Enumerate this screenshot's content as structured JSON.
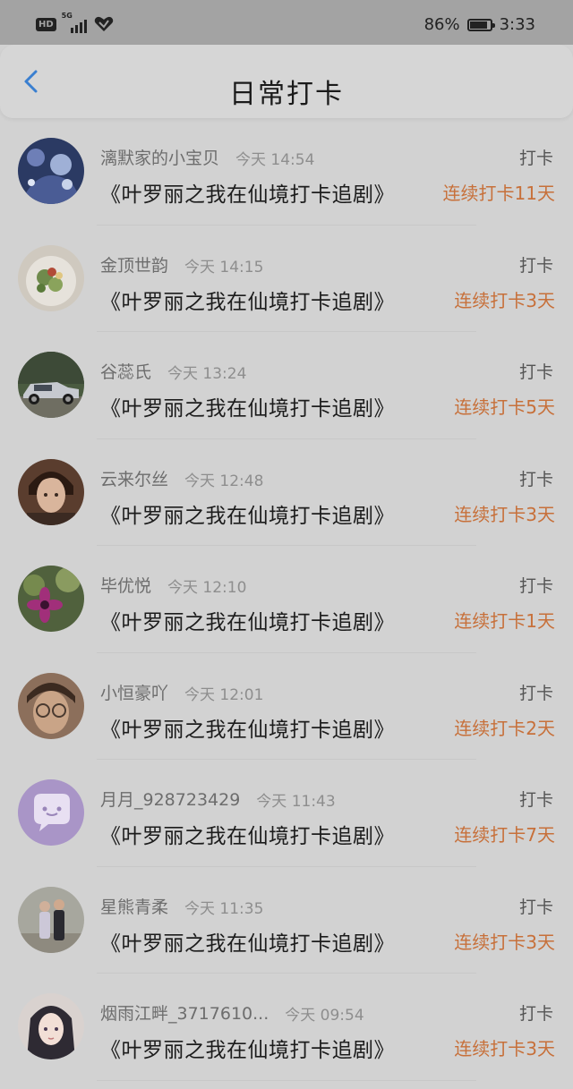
{
  "status_bar": {
    "network_badge": "HD",
    "network_type": "5G",
    "battery_percent": "86%",
    "battery_level": 0.86,
    "time": "3:33"
  },
  "header": {
    "title": "日常打卡",
    "back_icon": "chevron-left-icon"
  },
  "colors": {
    "accent_back": "#3a7fd0",
    "streak": "#c7703a"
  },
  "entries": [
    {
      "username": "漓默家的小宝贝",
      "time": "今天 14:54",
      "action": "打卡",
      "title": "《叶罗丽之我在仙境打卡追剧》",
      "streak": "连续打卡11天",
      "avatar": "anime-night-icon"
    },
    {
      "username": "金顶世韵",
      "time": "今天 14:15",
      "action": "打卡",
      "title": "《叶罗丽之我在仙境打卡追剧》",
      "streak": "连续打卡3天",
      "avatar": "salad-plate-icon"
    },
    {
      "username": "谷蕊氏",
      "time": "今天 13:24",
      "action": "打卡",
      "title": "《叶罗丽之我在仙境打卡追剧》",
      "streak": "连续打卡5天",
      "avatar": "vintage-car-icon"
    },
    {
      "username": "云来尔丝",
      "time": "今天 12:48",
      "action": "打卡",
      "title": "《叶罗丽之我在仙境打卡追剧》",
      "streak": "连续打卡3天",
      "avatar": "portrait-man-icon"
    },
    {
      "username": "毕优悦",
      "time": "今天 12:10",
      "action": "打卡",
      "title": "《叶罗丽之我在仙境打卡追剧》",
      "streak": "连续打卡1天",
      "avatar": "cactus-flower-icon"
    },
    {
      "username": "小恒豪吖",
      "time": "今天 12:01",
      "action": "打卡",
      "title": "《叶罗丽之我在仙境打卡追剧》",
      "streak": "连续打卡2天",
      "avatar": "portrait-glasses-icon"
    },
    {
      "username": "月月_928723429",
      "time": "今天 11:43",
      "action": "打卡",
      "title": "《叶罗丽之我在仙境打卡追剧》",
      "streak": "连续打卡7天",
      "avatar": "default-chat-icon"
    },
    {
      "username": "星熊青柔",
      "time": "今天 11:35",
      "action": "打卡",
      "title": "《叶罗丽之我在仙境打卡追剧》",
      "streak": "连续打卡3天",
      "avatar": "couple-photo-icon"
    },
    {
      "username": "烟雨江畔_3717610...",
      "time": "今天 09:54",
      "action": "打卡",
      "title": "《叶罗丽之我在仙境打卡追剧》",
      "streak": "连续打卡3天",
      "avatar": "anime-girl-icon"
    }
  ]
}
